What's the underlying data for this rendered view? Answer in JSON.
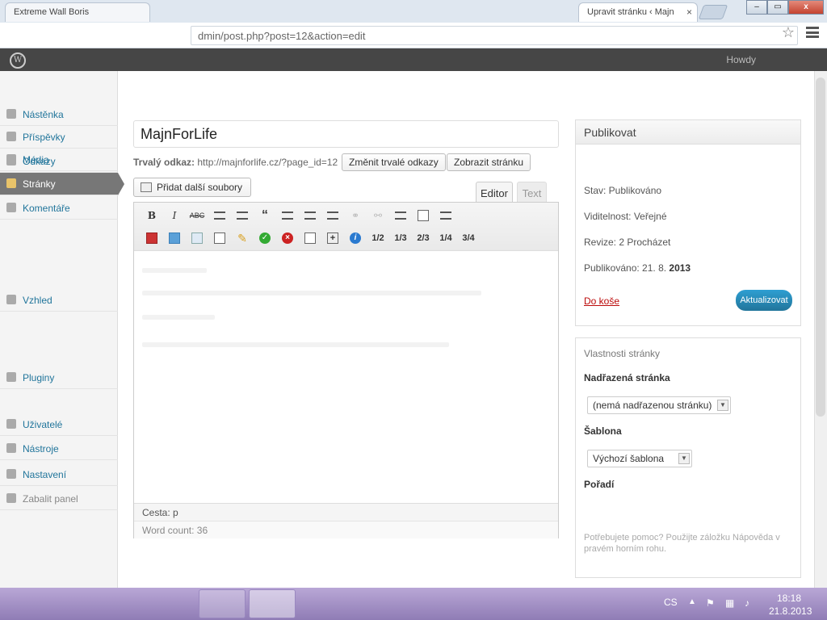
{
  "browser": {
    "tabs": [
      {
        "label": "Extreme Wall Boris"
      },
      {
        "label": "Upravit stránku ‹ Majn"
      }
    ],
    "address": "dmin/post.php?post=12&action=edit",
    "window_buttons": {
      "minimize": "–",
      "maximize": "▭",
      "close": "x"
    }
  },
  "adminbar": {
    "howdy": "Howdy"
  },
  "sidemenu": {
    "items": [
      {
        "label": "Nástěnka"
      },
      {
        "label": "Příspěvky"
      },
      {
        "label": "Média"
      },
      {
        "label": "Odkazy"
      },
      {
        "label": "Stránky"
      },
      {
        "label": "Komentáře"
      },
      {
        "label": "Vzhled"
      },
      {
        "label": "Pluginy"
      },
      {
        "label": "Uživatelé"
      },
      {
        "label": "Nástroje"
      },
      {
        "label": "Nastavení"
      },
      {
        "label": "Zabalit panel"
      }
    ]
  },
  "editor": {
    "title": "MajnForLife",
    "permalink_label": "Trvalý odkaz:",
    "permalink_url": "http://majnforlife.cz/?page_id=12",
    "change_permalink": "Změnit trvalé odkazy",
    "view_page": "Zobrazit stránku",
    "add_media": "Přidat další soubory",
    "tab_editor": "Editor",
    "tab_text": "Text",
    "toolbar_row1": [
      "B",
      "I",
      "ABC",
      "ul",
      "ol",
      "“",
      "left",
      "center",
      "right",
      "link",
      "unlink",
      "more",
      "fullscreen",
      "kitchen"
    ],
    "toolbar_row2_fractions": [
      "1/2",
      "1/3",
      "2/3",
      "1/4",
      "3/4"
    ],
    "path": "Cesta: p",
    "word_count": "Word count: 36"
  },
  "publish": {
    "title": "Publikovat",
    "status": "Stav: Publikováno",
    "visibility": "Viditelnost: Veřejné",
    "revisions": "Revize: 2 Procházet",
    "published_on_prefix": "Publikováno: 21. 8. ",
    "published_year": "2013",
    "delete": "Do koše",
    "update": "Aktualizovat"
  },
  "attributes": {
    "title": "Vlastnosti stránky",
    "parent_label": "Nadřazená stránka",
    "parent_value": "(nemá nadřazenou stránku)",
    "template_label": "Šablona",
    "template_value": "Výchozí šablona",
    "order_label": "Pořadí",
    "help": "Potřebujete pomoc? Použijte záložku Nápověda v pravém horním rohu."
  },
  "taskbar": {
    "lang": "CS",
    "time": "18:18",
    "date": "21.8.2013"
  }
}
